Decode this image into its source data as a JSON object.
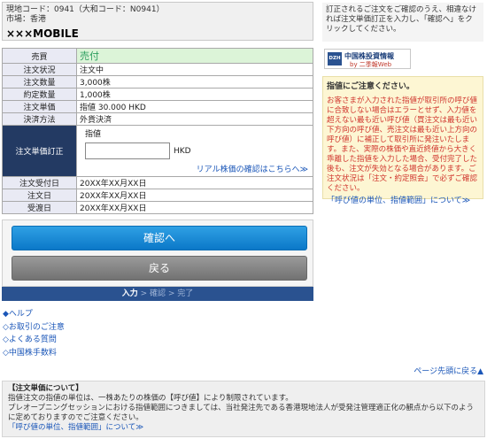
{
  "header": {
    "stock_code": "現地コード：0941（大和コード：N0941）",
    "market": "市場：香港",
    "stock_name": "×××MOBILE"
  },
  "instruction_note": "訂正されるご注文をご確認のうえ、相違なければ注文単価訂正を入力し、「確認へ」をクリックしてください。",
  "order": {
    "trade_label": "売買",
    "trade_value": "売付",
    "rows": [
      {
        "label": "注文状況",
        "value": "注文中"
      },
      {
        "label": "注文数量",
        "value": "3,000株"
      },
      {
        "label": "約定数量",
        "value": "1,000株"
      },
      {
        "label": "注文単価",
        "value": "指値 30.000 HKD"
      },
      {
        "label": "決済方法",
        "value": "外貨決済"
      }
    ],
    "price_correction_label": "注文単価訂正",
    "price_type": "指値",
    "price_input_value": "",
    "price_currency": "HKD",
    "realtime_link": "リアル株価の確認はこちらへ≫",
    "date_rows": [
      {
        "label": "注文受付日",
        "value": "20XX年XX月XX日"
      },
      {
        "label": "注文日",
        "value": "20XX年XX月XX日"
      },
      {
        "label": "受渡日",
        "value": "20XX年XX月XX日"
      }
    ]
  },
  "buttons": {
    "confirm": "確認へ",
    "back": "戻る"
  },
  "steps": {
    "current": "入力",
    "separator": " > ",
    "next1": "確認",
    "next2": "完了"
  },
  "help_links": [
    "◆ヘルプ",
    "◇お取引のご注意",
    "◇よくある質問",
    "◇中国株手数料"
  ],
  "promo": {
    "logo": "DZH",
    "title": "中国株投資情報",
    "subtitle": "by 二季報Web"
  },
  "warning": {
    "title": "指値にご注意ください。",
    "body": "お客さまが入力された指値が取引所の呼び値に合致しない場合はエラーとせず、入力値を超えない最も近い呼び値（買注文は最も近い下方向の呼び値、売注文は最も近い上方向の呼び値）に補正して取引所に発注いたします。また、実際の株価や直近終値から大きく乖離した指値を入力した場合、受付完了した後も、注文が失効となる場合があります。ご注文状況は「注文・約定照会」で必ずご確認ください。",
    "link": "「呼び値の単位、指値範囲」について≫"
  },
  "page_top": "ページ先頭に戻る▲",
  "bottom_note": {
    "title": "【注文単価について】",
    "line1": "指値注文の指値の単位は、一株あたりの株価の【呼び値】により制限されています。",
    "line2": "プレオープニングセッションにおける指値範囲につきましては、当社発注先である香港現地法人が受発注管理適正化の観点から以下のように定めておりますのでご注意ください。",
    "link": "「呼び値の単位、指値範囲」について≫"
  }
}
